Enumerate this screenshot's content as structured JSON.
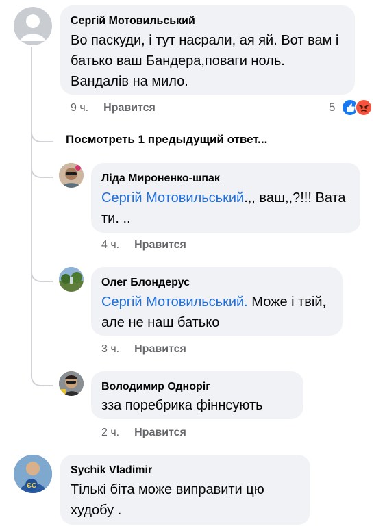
{
  "comments": [
    {
      "author": "Сергій Мотовильський",
      "text": "Во паскуди, і тут насрали, ая яй. Вот вам і батько ваш  Бандера,поваги ноль. Вандалів на мило.",
      "time": "9 ч.",
      "like": "Нравится",
      "reaction_count": "5"
    },
    {
      "author": "Ліда Мироненко-шпак",
      "mention": "Сергій Мотовильський",
      "text": ".,, ваш,,?!!! Вата ти. ..",
      "time": "4 ч.",
      "like": "Нравится"
    },
    {
      "author": "Олег Блондерус",
      "mention": "Сергій Мотовильський.",
      "text": " Може і твій, але не наш батько",
      "time": "3 ч.",
      "like": "Нравится"
    },
    {
      "author": "Володимир Одноріг",
      "text": "зза поребрика фіннсують",
      "time": "2 ч.",
      "like": "Нравится"
    },
    {
      "author": "Sychik Vladimir",
      "text": "Тількі біта може виправити цю худобу ."
    }
  ],
  "view_previous": "Посмотреть 1 предыдущий ответ...",
  "icons": {
    "like": "thumbs-up-icon",
    "angry": "angry-face-icon"
  },
  "colors": {
    "bubble": "#f0f2f5",
    "mention": "#216fdb",
    "meta": "#65676b",
    "like_blue": "#1877f2",
    "angry_orange": "#f5533d"
  },
  "avatar_badge": "ЄС"
}
